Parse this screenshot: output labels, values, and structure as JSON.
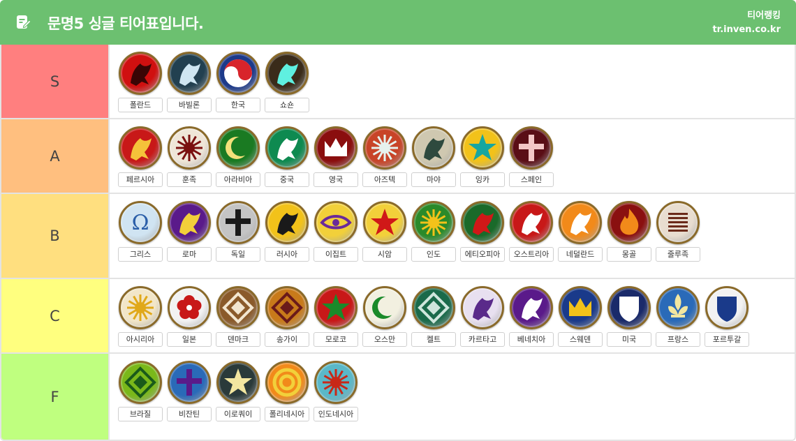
{
  "header": {
    "title": "문명5 싱글 티어표입니다.",
    "site_name": "티어랭킹",
    "site_url": "tr.inven.co.kr",
    "icon": "edit-note-icon"
  },
  "colors": {
    "header_bg": "#6cc070",
    "tier_S": "#ff7f7f",
    "tier_A": "#ffbf7f",
    "tier_B": "#ffdf7f",
    "tier_C": "#ffff7f",
    "tier_F": "#bfff7f"
  },
  "tiers": [
    {
      "label": "S",
      "civs": [
        {
          "name": "폴란드",
          "icon": "eagle-icon",
          "bg": "#d01010",
          "fg": "#3a0505"
        },
        {
          "name": "바빌론",
          "icon": "griffin-icon",
          "bg": "#224050",
          "fg": "#cfe6f2"
        },
        {
          "name": "한국",
          "icon": "taegeuk-icon",
          "bg": "#1d3a8a",
          "fg": "#d8242b"
        },
        {
          "name": "쇼숀",
          "icon": "feather-headdress-icon",
          "bg": "#3a2b1a",
          "fg": "#5ff0e0"
        }
      ]
    },
    {
      "label": "A",
      "civs": [
        {
          "name": "페르시아",
          "icon": "persian-symbol-icon",
          "bg": "#c81818",
          "fg": "#f5c23a"
        },
        {
          "name": "훈족",
          "icon": "sun-icon",
          "bg": "#efe6d8",
          "fg": "#7a1010"
        },
        {
          "name": "아라비아",
          "icon": "crescent-icon",
          "bg": "#1a7a22",
          "fg": "#f3e07a"
        },
        {
          "name": "중국",
          "icon": "dragon-icon",
          "bg": "#0e8a50",
          "fg": "#ffffff"
        },
        {
          "name": "영국",
          "icon": "crown-icon",
          "bg": "#8a0e0e",
          "fg": "#ffffff"
        },
        {
          "name": "아즈텍",
          "icon": "aztec-sun-icon",
          "bg": "#c84428",
          "fg": "#e6f2ee"
        },
        {
          "name": "마야",
          "icon": "mask-icon",
          "bg": "#cfc8b0",
          "fg": "#2e4a3e"
        },
        {
          "name": "잉카",
          "icon": "star-icon",
          "bg": "#f2c21a",
          "fg": "#17a6a0"
        },
        {
          "name": "스페인",
          "icon": "cross-icon",
          "bg": "#5a0e16",
          "fg": "#f3c6c6"
        }
      ]
    },
    {
      "label": "B",
      "civs": [
        {
          "name": "그리스",
          "icon": "omega-icon",
          "bg": "#d0e4f2",
          "fg": "#2a5ea8"
        },
        {
          "name": "로마",
          "icon": "laurel-icon",
          "bg": "#5a1a8a",
          "fg": "#f2cf3a"
        },
        {
          "name": "독일",
          "icon": "iron-cross-icon",
          "bg": "#c4c4c4",
          "fg": "#1a1a1a"
        },
        {
          "name": "러시아",
          "icon": "double-eagle-icon",
          "bg": "#f2c21a",
          "fg": "#1a1a1a"
        },
        {
          "name": "이집트",
          "icon": "eye-of-horus-icon",
          "bg": "#f2d03a",
          "fg": "#6a2a9a"
        },
        {
          "name": "시암",
          "icon": "star-burst-icon",
          "bg": "#f2d03a",
          "fg": "#d01818"
        },
        {
          "name": "인도",
          "icon": "chakra-icon",
          "bg": "#2a8a2a",
          "fg": "#f2c21a"
        },
        {
          "name": "에티오피아",
          "icon": "lion-icon",
          "bg": "#1a6a2a",
          "fg": "#d01818"
        },
        {
          "name": "오스트리아",
          "icon": "eagle-icon",
          "bg": "#c81818",
          "fg": "#ffffff"
        },
        {
          "name": "네덜란드",
          "icon": "lion-icon",
          "bg": "#f28a1a",
          "fg": "#ffffff"
        },
        {
          "name": "몽골",
          "icon": "flame-icon",
          "bg": "#8a1010",
          "fg": "#f28a1a"
        },
        {
          "name": "줄루족",
          "icon": "stripes-icon",
          "bg": "#e8ddd0",
          "fg": "#6a2a1a"
        }
      ]
    },
    {
      "label": "C",
      "civs": [
        {
          "name": "아시리아",
          "icon": "sun-star-icon",
          "bg": "#f2e6c8",
          "fg": "#e0a81a"
        },
        {
          "name": "일본",
          "icon": "flower-icon",
          "bg": "#f2f2f2",
          "fg": "#c81818"
        },
        {
          "name": "덴마크",
          "icon": "triquetra-icon",
          "bg": "#8a5a2a",
          "fg": "#f2e6d0"
        },
        {
          "name": "송가이",
          "icon": "diamond-pattern-icon",
          "bg": "#c87a1a",
          "fg": "#6a1a1a"
        },
        {
          "name": "모로코",
          "icon": "pentagram-icon",
          "bg": "#c81818",
          "fg": "#1a8a2a"
        },
        {
          "name": "오스만",
          "icon": "double-crescent-icon",
          "bg": "#f2f0e0",
          "fg": "#1a8a2a"
        },
        {
          "name": "켈트",
          "icon": "knot-icon",
          "bg": "#1a6a4a",
          "fg": "#cfe6dc"
        },
        {
          "name": "카르타고",
          "icon": "elephant-icon",
          "bg": "#e8e0f0",
          "fg": "#5a2a8a"
        },
        {
          "name": "베네치아",
          "icon": "winged-lion-icon",
          "bg": "#5a1a8a",
          "fg": "#ffffff"
        },
        {
          "name": "스웨덴",
          "icon": "three-crowns-icon",
          "bg": "#1a3a8a",
          "fg": "#f2c21a"
        },
        {
          "name": "미국",
          "icon": "shield-icon",
          "bg": "#1a2a6a",
          "fg": "#ffffff"
        },
        {
          "name": "프랑스",
          "icon": "fleur-de-lis-icon",
          "bg": "#2a6ab8",
          "fg": "#f2e6a0"
        },
        {
          "name": "포르투갈",
          "icon": "quinas-icon",
          "bg": "#f2f2f2",
          "fg": "#1a3a8a"
        }
      ]
    },
    {
      "label": "F",
      "civs": [
        {
          "name": "브라질",
          "icon": "compass-icon",
          "bg": "#7ab81a",
          "fg": "#1a5a1a"
        },
        {
          "name": "비잔틴",
          "icon": "orthodox-cross-icon",
          "bg": "#2a6ab8",
          "fg": "#5a1a8a"
        },
        {
          "name": "이로쿼이",
          "icon": "star-icon",
          "bg": "#2a3a3a",
          "fg": "#f2e6a0"
        },
        {
          "name": "폴리네시아",
          "icon": "spiral-icon",
          "bg": "#f28a1a",
          "fg": "#f2d03a"
        },
        {
          "name": "인도네시아",
          "icon": "sun-star-icon",
          "bg": "#5ab8c8",
          "fg": "#c82818"
        }
      ]
    }
  ]
}
